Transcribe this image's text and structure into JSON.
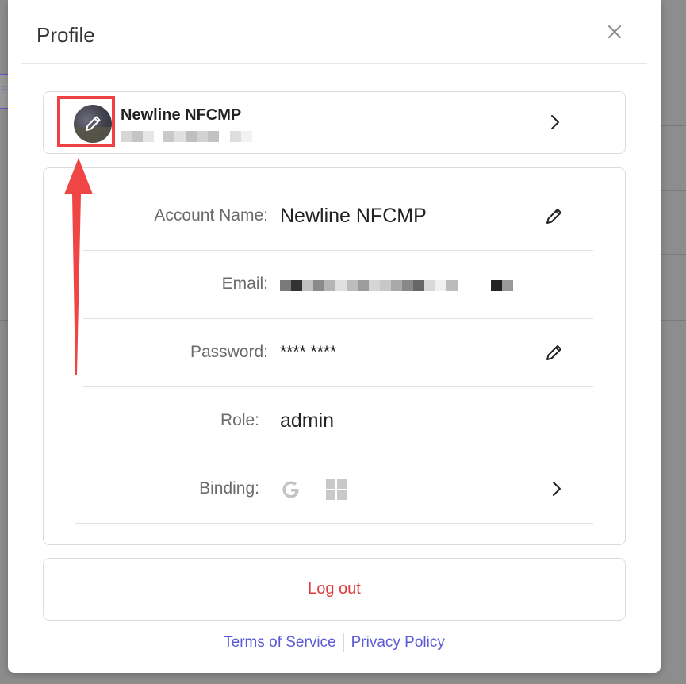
{
  "modal": {
    "title": "Profile"
  },
  "profile_card": {
    "name": "Newline NFCMP"
  },
  "details": {
    "rows": [
      {
        "label": "Account Name:",
        "value": "Newline NFCMP"
      },
      {
        "label": "Email:",
        "value": ""
      },
      {
        "label": "Password:",
        "value": "**** ****"
      },
      {
        "label": "Role:",
        "value": "admin"
      },
      {
        "label": "Binding:",
        "value": ""
      }
    ]
  },
  "binding_icons": [
    "google-icon",
    "microsoft-icon"
  ],
  "logout_label": "Log out",
  "footer": {
    "terms": "Terms of Service",
    "privacy": "Privacy Policy"
  },
  "colors": {
    "link": "#5b5bd6",
    "logout": "#e03b3b",
    "annotation": "#ef4242"
  }
}
